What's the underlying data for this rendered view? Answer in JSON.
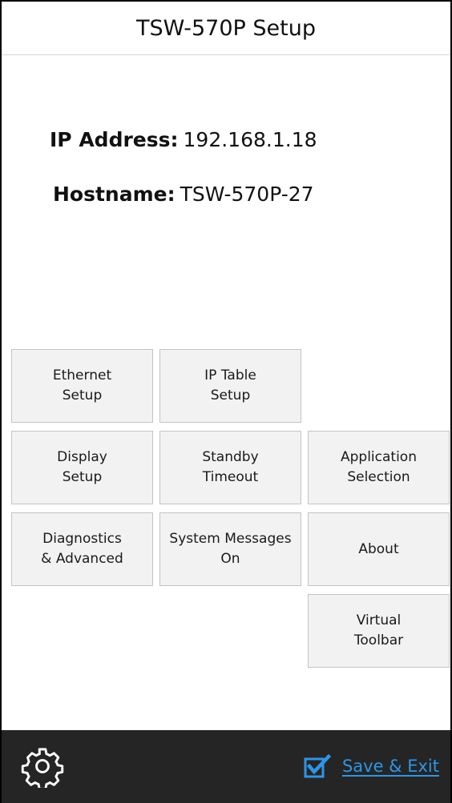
{
  "header": {
    "title": "TSW-570P Setup"
  },
  "info": {
    "ip_label": "IP Address:",
    "ip_value": "192.168.1.18",
    "hostname_label": "Hostname:",
    "hostname_value": "TSW-570P-27"
  },
  "tiles": {
    "ethernet_setup": "Ethernet\nSetup",
    "ip_table_setup": "IP Table\nSetup",
    "display_setup": "Display\nSetup",
    "standby_timeout": "Standby\nTimeout",
    "application_selection": "Application\nSelection",
    "diagnostics_advanced": "Diagnostics\n& Advanced",
    "system_messages": "System Messages\nOn",
    "about": "About",
    "virtual_toolbar": "Virtual\nToolbar"
  },
  "footer": {
    "settings_icon": "gear-icon",
    "save_exit_icon": "checkbox-checked-icon",
    "save_exit_label": "Save & Exit",
    "accent_color": "#2f95e6",
    "background_color": "#252525"
  }
}
